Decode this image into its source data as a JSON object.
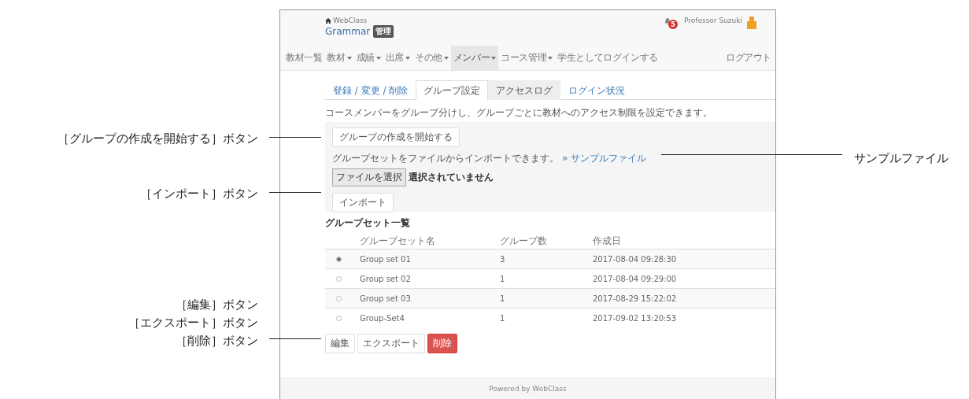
{
  "header": {
    "home_label": "WebClass",
    "course_title": "Grammar",
    "course_badge": "管理",
    "notification_count": "5",
    "user_name": "Professor Suzuki"
  },
  "nav": [
    {
      "label": "教材一覧",
      "dropdown": false,
      "selected": false
    },
    {
      "label": "教材",
      "dropdown": true,
      "selected": false
    },
    {
      "label": "成績",
      "dropdown": true,
      "selected": false
    },
    {
      "label": "出席",
      "dropdown": true,
      "selected": false
    },
    {
      "label": "その他",
      "dropdown": true,
      "selected": false
    },
    {
      "label": "メンバー",
      "dropdown": true,
      "selected": true
    },
    {
      "label": "コース管理",
      "dropdown": true,
      "selected": false
    },
    {
      "label": "学生としてログインする",
      "dropdown": false,
      "selected": false
    }
  ],
  "logout": "ログアウト",
  "tabs": [
    {
      "label": "登録 / 変更 / 削除",
      "selected": false,
      "hovered": false
    },
    {
      "label": "グループ設定",
      "selected": true,
      "hovered": false
    },
    {
      "label": "アクセスログ",
      "selected": false,
      "hovered": true
    },
    {
      "label": "ログイン状況",
      "selected": false,
      "hovered": false
    }
  ],
  "description": "コースメンバーをグループ分けし、グループごとに教材へのアクセス制限を設定できます。",
  "group_panel": {
    "start_button": "グループの作成を開始する",
    "import_text": "グループセットをファイルからインポートできます。",
    "sample_link": "» サンプルファイル",
    "file_button": "ファイルを選択",
    "file_status": "選択されていません",
    "import_button": "インポート"
  },
  "list_title": "グループセット一覧",
  "table": {
    "columns": [
      "グループセット名",
      "グループ数",
      "作成日"
    ],
    "rows": [
      {
        "selected": true,
        "name": "Group set 01",
        "count": "3",
        "created": "2017-08-04 09:28:30"
      },
      {
        "selected": false,
        "name": "Group set 02",
        "count": "1",
        "created": "2017-08-04 09:29:00"
      },
      {
        "selected": false,
        "name": "Group set 03",
        "count": "1",
        "created": "2017-08-29 15:22:02"
      },
      {
        "selected": false,
        "name": "Group-Set4",
        "count": "1",
        "created": "2017-09-02 13:20:53"
      }
    ]
  },
  "actions": [
    {
      "label": "編集",
      "kind": "default"
    },
    {
      "label": "エクスポート",
      "kind": "default"
    },
    {
      "label": "削除",
      "kind": "danger"
    }
  ],
  "footer": "Powered by WebClass",
  "annotations": [
    {
      "labels": [
        "［グループの作成を開始する］ボタン"
      ]
    },
    {
      "labels": [
        "［インポート］ボタン"
      ]
    },
    {
      "labels": [
        "［編集］ボタン",
        "［エクスポート］ボタン",
        "［削除］ボタン"
      ]
    },
    {
      "labels": [
        "サンプルファイル"
      ]
    }
  ]
}
